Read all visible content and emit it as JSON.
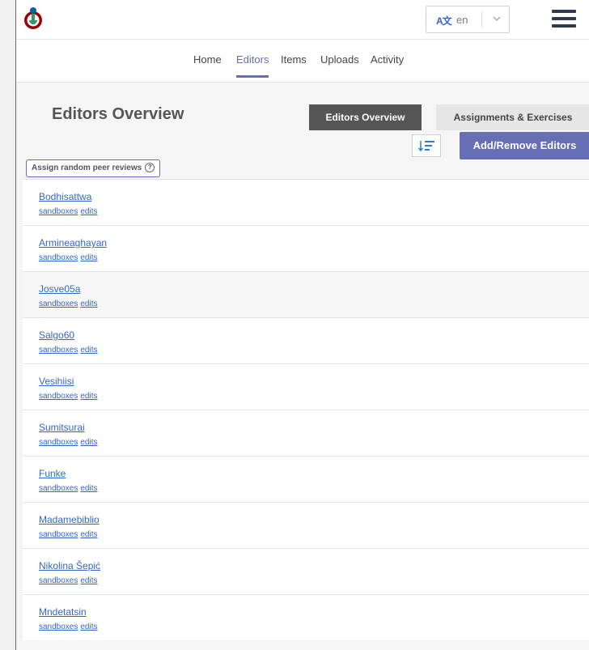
{
  "header": {
    "language": "en",
    "language_icon": "translate-icon"
  },
  "nav": {
    "items": [
      "Home",
      "Editors",
      "Items",
      "Uploads",
      "Activity"
    ],
    "active": "Editors"
  },
  "main": {
    "title": "Editors Overview",
    "tabs": [
      "Editors Overview",
      "Assignments & Exercises"
    ],
    "add_remove_label": "Add/Remove Editors",
    "peer_review_label": "Assign random peer reviews",
    "peer_review_help": "?"
  },
  "editors": [
    {
      "name": "Bodhisattwa",
      "sandboxes": "sandboxes",
      "edits": "edits"
    },
    {
      "name": "Armineaghayan",
      "sandboxes": "sandboxes",
      "edits": "edits"
    },
    {
      "name": "Josve05a",
      "sandboxes": "sandboxes",
      "edits": "edits"
    },
    {
      "name": "Salgo60",
      "sandboxes": "sandboxes",
      "edits": "edits"
    },
    {
      "name": "Vesihiisi",
      "sandboxes": "sandboxes",
      "edits": "edits"
    },
    {
      "name": "Sumitsurai",
      "sandboxes": "sandboxes",
      "edits": "edits"
    },
    {
      "name": "Funke",
      "sandboxes": "sandboxes",
      "edits": "edits"
    },
    {
      "name": "Madamebiblio",
      "sandboxes": "sandboxes",
      "edits": "edits"
    },
    {
      "name": "Nikolina Šepić",
      "sandboxes": "sandboxes",
      "edits": "edits"
    },
    {
      "name": "Mndetatsin",
      "sandboxes": "sandboxes",
      "edits": "edits"
    }
  ],
  "colors": {
    "accent": "#676eb4",
    "link": "#3366cc",
    "dark_button": "#555555"
  }
}
